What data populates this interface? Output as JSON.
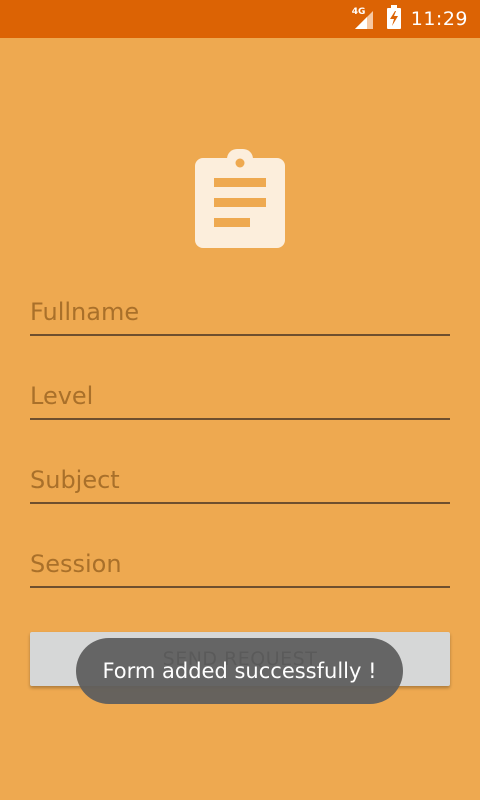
{
  "status_bar": {
    "network": "4G",
    "time": "11:29",
    "color": "#DC6304"
  },
  "theme": {
    "background": "#EEA950",
    "icon_color": "#FCEEDC",
    "underline_color": "#6E4F2E"
  },
  "header": {
    "icon": "clipboard-icon"
  },
  "form": {
    "fields": [
      {
        "placeholder": "Fullname"
      },
      {
        "placeholder": "Level"
      },
      {
        "placeholder": "Subject"
      },
      {
        "placeholder": "Session"
      }
    ],
    "submit_label": "SEND REQUEST"
  },
  "toast": {
    "message": "Form added successfully !"
  }
}
